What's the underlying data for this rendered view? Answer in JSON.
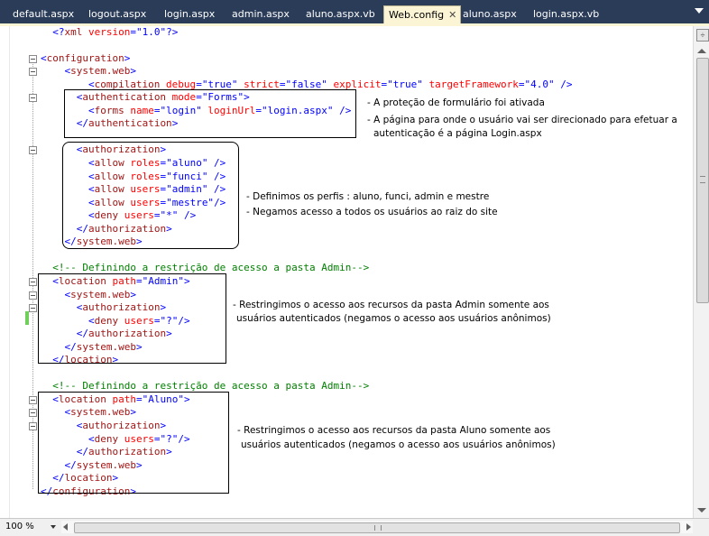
{
  "tabs": [
    {
      "label": "default.aspx",
      "active": false
    },
    {
      "label": "logout.aspx",
      "active": false
    },
    {
      "label": "login.aspx",
      "active": false
    },
    {
      "label": "admin.aspx",
      "active": false
    },
    {
      "label": "aluno.aspx.vb",
      "active": false
    },
    {
      "label": "Web.config",
      "active": true
    },
    {
      "label": "aluno.aspx",
      "active": false
    },
    {
      "label": "login.aspx.vb",
      "active": false
    }
  ],
  "tab_close_glyph": "✕",
  "icons": {
    "close": "close-icon",
    "split": "split-handle-icon",
    "dropdown": "chevron-down-icon"
  },
  "colors": {
    "tab_bar": "#2b3c59",
    "active_tab": "#fbf5d6",
    "xml_tag": "#a31515",
    "xml_attr": "#ff0000",
    "xml_value": "#0000ff",
    "comment": "#008000"
  },
  "code_lines": [
    {
      "indent": 2,
      "collapse": false,
      "parts": [
        {
          "t": "<?",
          "c": "b"
        },
        {
          "t": "xml",
          "c": "m"
        },
        {
          "t": " version",
          "c": "r"
        },
        {
          "t": "=",
          "c": "b"
        },
        {
          "t": "\"1.0\"",
          "c": "b"
        },
        {
          "t": "?>",
          "c": "b"
        }
      ]
    },
    {
      "indent": 0,
      "collapse": false,
      "parts": []
    },
    {
      "indent": 0,
      "collapse": true,
      "parts": [
        {
          "t": "<",
          "c": "b"
        },
        {
          "t": "configuration",
          "c": "m"
        },
        {
          "t": ">",
          "c": "b"
        }
      ]
    },
    {
      "indent": 4,
      "collapse": true,
      "parts": [
        {
          "t": "<",
          "c": "b"
        },
        {
          "t": "system.web",
          "c": "m"
        },
        {
          "t": ">",
          "c": "b"
        }
      ]
    },
    {
      "indent": 8,
      "collapse": false,
      "parts": [
        {
          "t": "<",
          "c": "b"
        },
        {
          "t": "compilation",
          "c": "m"
        },
        {
          "t": " debug",
          "c": "r"
        },
        {
          "t": "=",
          "c": "b"
        },
        {
          "t": "\"true\"",
          "c": "b"
        },
        {
          "t": " strict",
          "c": "r"
        },
        {
          "t": "=",
          "c": "b"
        },
        {
          "t": "\"false\"",
          "c": "b"
        },
        {
          "t": " explicit",
          "c": "r"
        },
        {
          "t": "=",
          "c": "b"
        },
        {
          "t": "\"true\"",
          "c": "b"
        },
        {
          "t": " targetFramework",
          "c": "r"
        },
        {
          "t": "=",
          "c": "b"
        },
        {
          "t": "\"4.0\"",
          "c": "b"
        },
        {
          "t": " />",
          "c": "b"
        }
      ]
    },
    {
      "indent": 6,
      "collapse": true,
      "parts": [
        {
          "t": "<",
          "c": "b"
        },
        {
          "t": "authentication",
          "c": "m"
        },
        {
          "t": " mode",
          "c": "r"
        },
        {
          "t": "=",
          "c": "b"
        },
        {
          "t": "\"Forms\"",
          "c": "b"
        },
        {
          "t": ">",
          "c": "b"
        }
      ]
    },
    {
      "indent": 8,
      "collapse": false,
      "parts": [
        {
          "t": "<",
          "c": "b"
        },
        {
          "t": "forms",
          "c": "m"
        },
        {
          "t": " name",
          "c": "r"
        },
        {
          "t": "=",
          "c": "b"
        },
        {
          "t": "\"login\"",
          "c": "b"
        },
        {
          "t": " loginUrl",
          "c": "r"
        },
        {
          "t": "=",
          "c": "b"
        },
        {
          "t": "\"login.aspx\"",
          "c": "b"
        },
        {
          "t": " />",
          "c": "b"
        }
      ]
    },
    {
      "indent": 6,
      "collapse": false,
      "parts": [
        {
          "t": "</",
          "c": "b"
        },
        {
          "t": "authentication",
          "c": "m"
        },
        {
          "t": ">",
          "c": "b"
        }
      ]
    },
    {
      "indent": 0,
      "collapse": false,
      "parts": []
    },
    {
      "indent": 6,
      "collapse": true,
      "parts": [
        {
          "t": "<",
          "c": "b"
        },
        {
          "t": "authorization",
          "c": "m"
        },
        {
          "t": ">",
          "c": "b"
        }
      ]
    },
    {
      "indent": 8,
      "collapse": false,
      "parts": [
        {
          "t": "<",
          "c": "b"
        },
        {
          "t": "allow",
          "c": "m"
        },
        {
          "t": " roles",
          "c": "r"
        },
        {
          "t": "=",
          "c": "b"
        },
        {
          "t": "\"aluno\"",
          "c": "b"
        },
        {
          "t": " />",
          "c": "b"
        }
      ]
    },
    {
      "indent": 8,
      "collapse": false,
      "parts": [
        {
          "t": "<",
          "c": "b"
        },
        {
          "t": "allow",
          "c": "m"
        },
        {
          "t": " roles",
          "c": "r"
        },
        {
          "t": "=",
          "c": "b"
        },
        {
          "t": "\"funci\"",
          "c": "b"
        },
        {
          "t": " />",
          "c": "b"
        }
      ]
    },
    {
      "indent": 8,
      "collapse": false,
      "parts": [
        {
          "t": "<",
          "c": "b"
        },
        {
          "t": "allow",
          "c": "m"
        },
        {
          "t": " users",
          "c": "r"
        },
        {
          "t": "=",
          "c": "b"
        },
        {
          "t": "\"admin\"",
          "c": "b"
        },
        {
          "t": " />",
          "c": "b"
        }
      ]
    },
    {
      "indent": 8,
      "collapse": false,
      "parts": [
        {
          "t": "<",
          "c": "b"
        },
        {
          "t": "allow",
          "c": "m"
        },
        {
          "t": " users",
          "c": "r"
        },
        {
          "t": "=",
          "c": "b"
        },
        {
          "t": "\"mestre\"",
          "c": "b"
        },
        {
          "t": "/>",
          "c": "b"
        }
      ]
    },
    {
      "indent": 8,
      "collapse": false,
      "parts": [
        {
          "t": "<",
          "c": "b"
        },
        {
          "t": "deny",
          "c": "m"
        },
        {
          "t": " users",
          "c": "r"
        },
        {
          "t": "=",
          "c": "b"
        },
        {
          "t": "\"*\"",
          "c": "b"
        },
        {
          "t": " />",
          "c": "b"
        }
      ]
    },
    {
      "indent": 6,
      "collapse": false,
      "parts": [
        {
          "t": "</",
          "c": "b"
        },
        {
          "t": "authorization",
          "c": "m"
        },
        {
          "t": ">",
          "c": "b"
        }
      ]
    },
    {
      "indent": 4,
      "collapse": false,
      "parts": [
        {
          "t": "</",
          "c": "b"
        },
        {
          "t": "system.web",
          "c": "m"
        },
        {
          "t": ">",
          "c": "b"
        }
      ]
    },
    {
      "indent": 0,
      "collapse": false,
      "parts": []
    },
    {
      "indent": 2,
      "collapse": false,
      "parts": [
        {
          "t": "<!-- Definindo a restrição de acesso a pasta Admin-->",
          "c": "g"
        }
      ]
    },
    {
      "indent": 2,
      "collapse": true,
      "parts": [
        {
          "t": "<",
          "c": "b"
        },
        {
          "t": "location",
          "c": "m"
        },
        {
          "t": " path",
          "c": "r"
        },
        {
          "t": "=",
          "c": "b"
        },
        {
          "t": "\"Admin\"",
          "c": "b"
        },
        {
          "t": ">",
          "c": "b"
        }
      ]
    },
    {
      "indent": 4,
      "collapse": true,
      "parts": [
        {
          "t": "<",
          "c": "b"
        },
        {
          "t": "system.web",
          "c": "m"
        },
        {
          "t": ">",
          "c": "b"
        }
      ]
    },
    {
      "indent": 6,
      "collapse": true,
      "parts": [
        {
          "t": "<",
          "c": "b"
        },
        {
          "t": "authorization",
          "c": "m"
        },
        {
          "t": ">",
          "c": "b"
        }
      ]
    },
    {
      "indent": 8,
      "collapse": false,
      "parts": [
        {
          "t": "<",
          "c": "b"
        },
        {
          "t": "deny",
          "c": "m"
        },
        {
          "t": " users",
          "c": "r"
        },
        {
          "t": "=",
          "c": "b"
        },
        {
          "t": "\"?\"",
          "c": "b"
        },
        {
          "t": "/>",
          "c": "b"
        }
      ]
    },
    {
      "indent": 6,
      "collapse": false,
      "parts": [
        {
          "t": "</",
          "c": "b"
        },
        {
          "t": "authorization",
          "c": "m"
        },
        {
          "t": ">",
          "c": "b"
        }
      ]
    },
    {
      "indent": 4,
      "collapse": false,
      "parts": [
        {
          "t": "</",
          "c": "b"
        },
        {
          "t": "system.web",
          "c": "m"
        },
        {
          "t": ">",
          "c": "b"
        }
      ]
    },
    {
      "indent": 2,
      "collapse": false,
      "parts": [
        {
          "t": "</",
          "c": "b"
        },
        {
          "t": "location",
          "c": "m"
        },
        {
          "t": ">",
          "c": "b"
        }
      ]
    },
    {
      "indent": 0,
      "collapse": false,
      "parts": []
    },
    {
      "indent": 2,
      "collapse": false,
      "parts": [
        {
          "t": "<!-- Definindo a restrição de acesso a pasta Admin-->",
          "c": "g"
        }
      ]
    },
    {
      "indent": 2,
      "collapse": true,
      "parts": [
        {
          "t": "<",
          "c": "b"
        },
        {
          "t": "location",
          "c": "m"
        },
        {
          "t": " path",
          "c": "r"
        },
        {
          "t": "=",
          "c": "b"
        },
        {
          "t": "\"Aluno\"",
          "c": "b"
        },
        {
          "t": ">",
          "c": "b"
        }
      ]
    },
    {
      "indent": 4,
      "collapse": true,
      "parts": [
        {
          "t": "<",
          "c": "b"
        },
        {
          "t": "system.web",
          "c": "m"
        },
        {
          "t": ">",
          "c": "b"
        }
      ]
    },
    {
      "indent": 6,
      "collapse": true,
      "parts": [
        {
          "t": "<",
          "c": "b"
        },
        {
          "t": "authorization",
          "c": "m"
        },
        {
          "t": ">",
          "c": "b"
        }
      ]
    },
    {
      "indent": 8,
      "collapse": false,
      "parts": [
        {
          "t": "<",
          "c": "b"
        },
        {
          "t": "deny",
          "c": "m"
        },
        {
          "t": " users",
          "c": "r"
        },
        {
          "t": "=",
          "c": "b"
        },
        {
          "t": "\"?\"",
          "c": "b"
        },
        {
          "t": "/>",
          "c": "b"
        }
      ]
    },
    {
      "indent": 6,
      "collapse": false,
      "parts": [
        {
          "t": "</",
          "c": "b"
        },
        {
          "t": "authorization",
          "c": "m"
        },
        {
          "t": ">",
          "c": "b"
        }
      ]
    },
    {
      "indent": 4,
      "collapse": false,
      "parts": [
        {
          "t": "</",
          "c": "b"
        },
        {
          "t": "system.web",
          "c": "m"
        },
        {
          "t": ">",
          "c": "b"
        }
      ]
    },
    {
      "indent": 2,
      "collapse": false,
      "parts": [
        {
          "t": "</",
          "c": "b"
        },
        {
          "t": "location",
          "c": "m"
        },
        {
          "t": ">",
          "c": "b"
        }
      ]
    },
    {
      "indent": 0,
      "collapse": false,
      "parts": [
        {
          "t": "</",
          "c": "b"
        },
        {
          "t": "configuration",
          "c": "m"
        },
        {
          "t": ">",
          "c": "b"
        }
      ]
    }
  ],
  "notes": {
    "auth_1": "- A proteção de formulário foi ativada",
    "auth_2a": "- A página para onde o usuário vai ser direcionado para efetuar a",
    "auth_2b": "autenticação é a página Login.aspx",
    "authz_1": "- Definimos os perfis : aluno, funci, admin e mestre",
    "authz_2": "- Negamos acesso a todos os usuários ao raiz do site",
    "admin_1": "- Restringimos o acesso aos recursos da pasta Admin somente aos",
    "admin_2": "usuários autenticados (negamos o acesso aos usuários anônimos)",
    "aluno_1": "- Restringimos o acesso aos recursos da pasta Aluno somente aos",
    "aluno_2": "usuários autenticados (negamos o acesso aos usuários anônimos)"
  },
  "status": {
    "zoom": "100 %"
  }
}
